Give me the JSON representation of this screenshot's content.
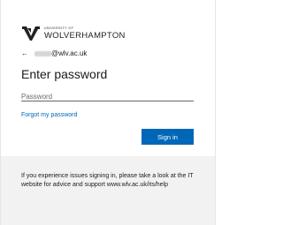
{
  "logo": {
    "university_of": "UNIVERSITY OF",
    "name": "WOLVERHAMPTON",
    "icon": "wolf-shield-logo"
  },
  "identity": {
    "back_icon": "back-arrow-icon",
    "back_glyph": "←",
    "email_domain": "@wlv.ac.uk"
  },
  "title": "Enter password",
  "password": {
    "placeholder": "Password",
    "value": ""
  },
  "forgot_link": "Forgot my password",
  "signin_button": "Sign in",
  "help_text": "If you experience issues signing in, please take a look at the IT website for advice and support www.wlv.ac.uk/its/help",
  "colors": {
    "accent": "#0067b8",
    "footer_bg": "#f2f2f2"
  }
}
